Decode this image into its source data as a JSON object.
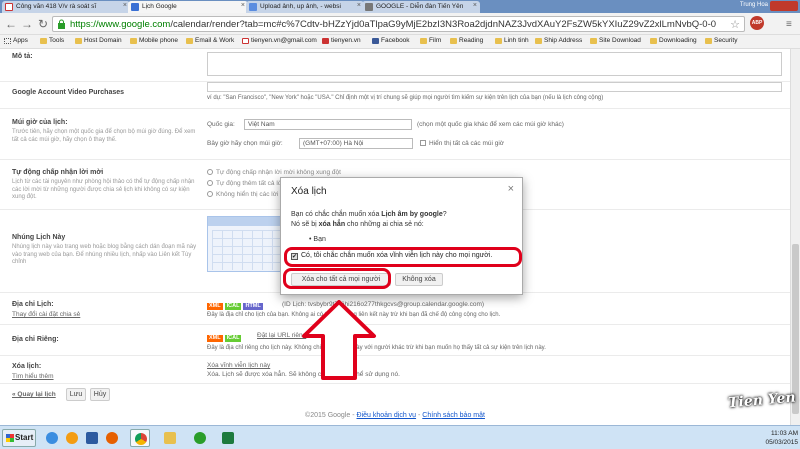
{
  "browser": {
    "tabs": [
      {
        "label": "Công văn 418 V/v rà soát sĩ",
        "icon": "gmail-icon"
      },
      {
        "label": "Lịch Google",
        "icon": "calendar-icon"
      },
      {
        "label": "Upload ảnh, up ảnh, - websi",
        "icon": "upload-icon"
      },
      {
        "label": "GOOGLE - Diễn đàn Tiến Yên",
        "icon": "forum-icon"
      }
    ],
    "user": "Trung Hoa",
    "url_host": "https://www.google.com",
    "url_path": "/calendar/render?tab=mc#c%7Cdtv-bHZzYjd0aTlpaG9yMjE2bzI3N3Roa2djdnNAZ3JvdXAuY2FsZW5kYXIuZ29vZ2xlLmNvbQ-0-0",
    "adblock": "ABP",
    "bookmarks": [
      "Apps",
      "Tools",
      "Host Domain",
      "Mobile phone",
      "Email & Work",
      "tienyen.vn@gmail.com",
      "tienyen.vn",
      "Facebook",
      "Film",
      "Reading",
      "Linh tinh",
      "Ship Address",
      "Site Download",
      "Downloading",
      "Security"
    ]
  },
  "settings": {
    "mo_ta_label": "Mô tả:",
    "video_label": "Google Account Video Purchases",
    "location_hint": "ví dụ: \"San Francisco\", \"New York\" hoặc \"USA.\" Chỉ định một vị trí chung sẽ giúp mọi người tìm kiếm sự kiện trên lịch của bạn (nếu là lịch công cộng)",
    "timezone_label": "Múi giờ của lịch:",
    "timezone_desc": "Trước tiên, hãy chọn một quốc gia để chọn bộ múi giờ đúng. Để xem tất cả các múi giờ, hãy chọn ô thay thế.",
    "country_label": "Quốc gia:",
    "country_value": "Việt Nam",
    "country_hint": "(chọn một quốc gia khác để xem các múi giờ khác)",
    "tz_now_label": "Bây giờ hãy chọn múi giờ:",
    "tz_value": "(GMT+07:00) Hà Nội",
    "show_all_tz": "Hiển thị tất cả các múi giờ",
    "auto_accept_label": "Tự động chấp nhận lời mời",
    "auto_accept_desc": "Lịch từ các tài nguyên như phòng hội thảo có thể tự động chấp nhận các lời mời từ những người được chia sẻ lịch khi không có sự kiện xung đột.",
    "radio_1": "Tự động chấp nhận lời mời không xung đột",
    "radio_2": "Tự động thêm tất cả lời mời vào lịch này",
    "radio_3": "Không hiển thị các lời mời",
    "embed_label": "Nhúng Lịch Này",
    "embed_desc": "Nhúng lịch này vào trang web hoặc blog bằng cách dán đoạn mã này vào trang web của bạn. Để nhúng nhiều lịch, nhấp vào Liên kết Tùy chỉnh",
    "address_label": "Địa chỉ Lịch:",
    "address_link": "Thay đổi cài đặt chia sẻ",
    "xml": "XML",
    "ical": "ICAL",
    "html": "HTML",
    "calendar_id": "(ID Lịch: tvsbybr9t7hiihi216o277thkgcvs@group.calendar.google.com)",
    "address_desc": "Đây là địa chỉ cho lịch của bạn. Không ai có thể sử dụng liên kết này trừ khi bạn đã chế độ công cộng cho lịch.",
    "private_label": "Địa chỉ Riêng:",
    "reset_private": "Đặt lại URL riêng",
    "private_desc": "Đây là địa chỉ riêng cho lịch này. Không chia sẻ địa chỉ này với người khác trừ khi bạn muốn họ thấy tất cả sự kiện trên lịch này.",
    "delete_label": "Xóa lịch:",
    "delete_learn": "Tìm hiểu thêm",
    "delete_link": "Xóa vĩnh viễn lịch này",
    "delete_desc": "Xóa. Lịch sẽ được xóa hẳn. Sẽ không có ai còn có thể sử dụng nó.",
    "back_link": "« Quay lại lịch",
    "save": "Lưu",
    "cancel": "Hủy",
    "footer_copy": "©2015 Google -",
    "footer_terms": "Điều khoản dịch vụ",
    "footer_privacy": "Chính sách bảo mật"
  },
  "dialog": {
    "title": "Xóa lịch",
    "line1_pre": "Bạn có chắc chắn muốn xóa",
    "line1_bold": "Lịch âm by google",
    "line1_post": "?",
    "line2_pre": "Nó sẽ bị",
    "line2_bold": "xóa hẳn",
    "line2_post": "cho những ai chia sẻ nó:",
    "share_list": "Bạn",
    "confirm": "Có, tôi chắc chắn muốn xóa vĩnh viễn lịch này cho mọi người.",
    "delete_all": "Xóa cho tất cả mọi người",
    "no_delete": "Không xóa"
  },
  "taskbar": {
    "start": "Start",
    "time": "11:03 AM",
    "date": "05/03/2015"
  },
  "watermark": "Tien Yen .VN",
  "colors": {
    "highlight": "#e0001b",
    "link": "#1155cc"
  }
}
